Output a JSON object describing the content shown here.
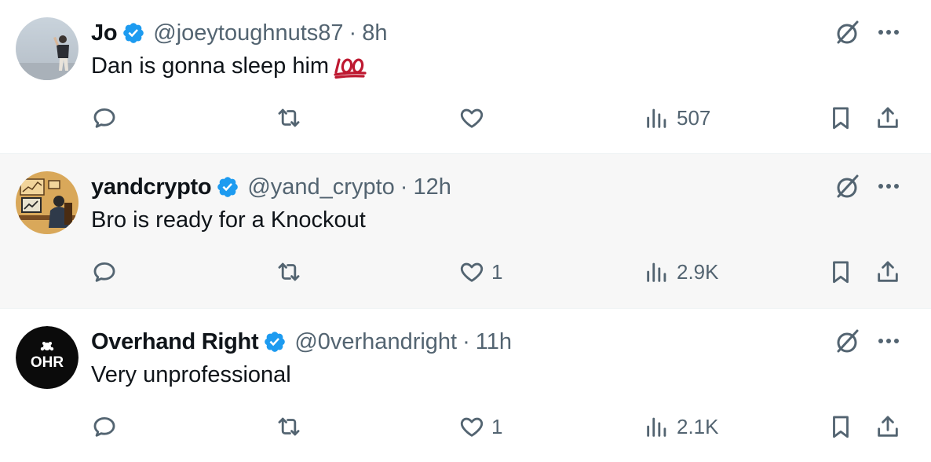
{
  "tweets": [
    {
      "display_name": "Jo",
      "handle": "@joeytoughnuts87",
      "separator": "·",
      "time": "8h",
      "text": "Dan is gonna sleep him",
      "emoji": "💯",
      "likes": "",
      "views": "507",
      "avatar": "photo-person-standing-icon"
    },
    {
      "display_name": "yandcrypto",
      "handle": "@yand_crypto",
      "separator": "·",
      "time": "12h",
      "text": "Bro is ready for a Knockout",
      "emoji": "",
      "likes": "1",
      "views": "2.9K",
      "avatar": "cartoon-trader-desk-icon"
    },
    {
      "display_name": "Overhand Right",
      "handle": "@0verhandright",
      "separator": "·",
      "time": "11h",
      "text": "Very unprofessional",
      "emoji": "",
      "likes": "1",
      "views": "2.1K",
      "avatar": "OHR"
    }
  ],
  "colors": {
    "text_primary": "#0f1419",
    "text_secondary": "#536471",
    "verified_blue": "#1d9bf0",
    "hover_row_bg": "#f7f7f7",
    "emoji_red": "#be1931"
  },
  "icons": {
    "reply": "reply-bubble-icon",
    "retweet": "retweet-icon",
    "like": "heart-icon",
    "views": "views-bar-chart-icon",
    "bookmark": "bookmark-icon",
    "share": "share-upload-icon",
    "grok": "grok-slash-icon",
    "more": "more-dots-icon",
    "verified": "verified-badge-icon"
  }
}
